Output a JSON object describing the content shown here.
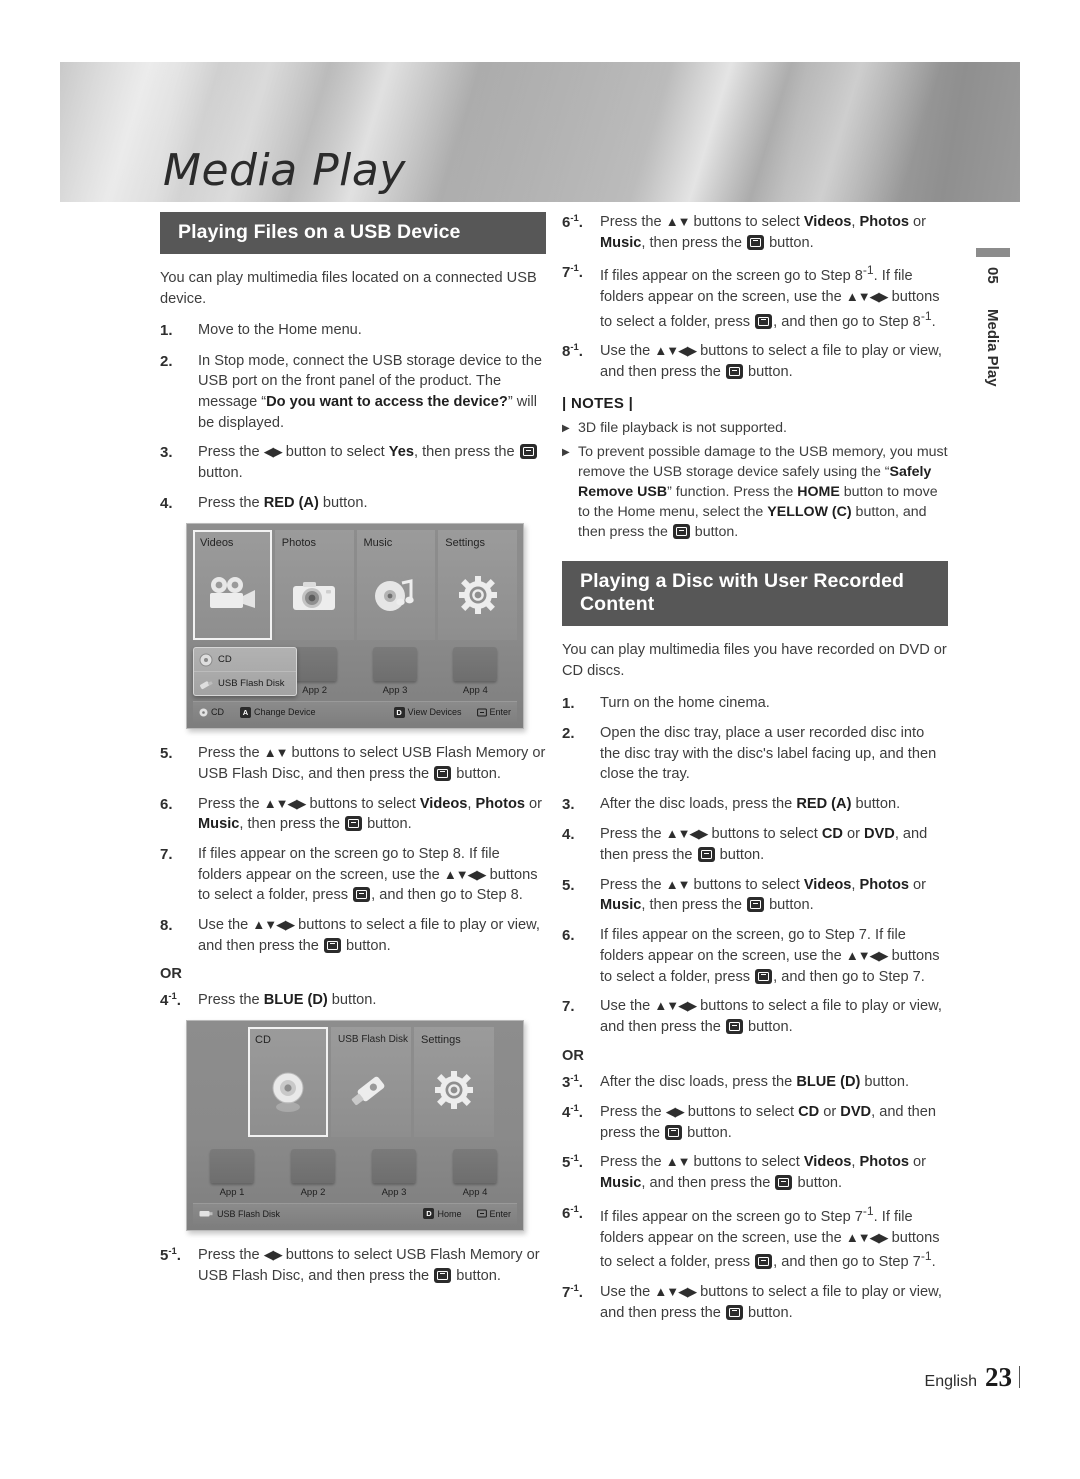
{
  "banner": {
    "title": "Media Play"
  },
  "chapter_tab": {
    "number": "05",
    "name": "Media Play"
  },
  "footer": {
    "language": "English",
    "page_number": "23"
  },
  "left_column": {
    "section_heading": "Playing Files on a USB Device",
    "intro": "You can play multimedia files located on a connected USB device.",
    "steps": [
      {
        "num": "1.",
        "text": "Move to the Home menu."
      },
      {
        "num": "2.",
        "text": "In Stop mode, connect the USB storage device to the USB port on the front panel of the product. The message “Do you want to access the device?” will be displayed."
      },
      {
        "num": "3.",
        "text": "Press the ◀▶ button to select Yes, then press the [ENTER] button."
      },
      {
        "num": "4.",
        "text": "Press the RED (A) button."
      }
    ],
    "steps_after_figure": [
      {
        "num": "5.",
        "text": "Press the ▲▼ buttons to select USB Flash Memory or USB Flash Disc, and then press the [ENTER] button."
      },
      {
        "num": "6.",
        "text": "Press the ▲▼◀▶ buttons to select Videos, Photos or Music, then press the [ENTER] button."
      },
      {
        "num": "7.",
        "text": "If files appear on the screen go to Step 8. If file folders appear on the screen, use the ▲▼◀▶ buttons to select a folder, press [ENTER], and then go to Step 8."
      },
      {
        "num": "8.",
        "text": "Use the ▲▼◀▶ buttons to select a file to play or view, and then press the [ENTER] button."
      }
    ],
    "or_label": "OR",
    "alt_step": {
      "num": "4",
      "sup": "-1",
      "text": "Press the BLUE (D) button."
    },
    "final_step": {
      "num": "5",
      "sup": "-1",
      "text": "Press the ◀▶ buttons to select USB Flash Memory or USB Flash Disc, and then press the [ENTER] button."
    }
  },
  "right_column": {
    "steps_top": [
      {
        "num": "6",
        "sup": "-1",
        "text": "Press the ▲▼ buttons to select Videos, Photos or Music, then press the [ENTER] button."
      },
      {
        "num": "7",
        "sup": "-1",
        "text": "If files appear on the screen go to Step 8-1. If file folders appear on the screen, use the ▲▼◀▶ buttons to select a folder, press [ENTER], and then go to Step 8-1."
      },
      {
        "num": "8",
        "sup": "-1",
        "text": "Use the ▲▼◀▶ buttons to select a file to play or view, and then press the [ENTER] button."
      }
    ],
    "notes_title": "| NOTES |",
    "notes": [
      "3D file playback is not supported.",
      "To prevent possible damage to the USB memory, you must remove the USB storage device safely using the “Safely Remove USB” function. Press the HOME button to move to the Home menu, select the YELLOW (C) button, and then press the [ENTER] button."
    ],
    "section_heading": "Playing a Disc with User Recorded Content",
    "intro": "You can play multimedia files you have recorded on DVD or CD discs.",
    "steps": [
      {
        "num": "1.",
        "text": "Turn on the home cinema."
      },
      {
        "num": "2.",
        "text": "Open the disc tray, place a user recorded disc into the disc tray with the disc's label facing up, and then close the tray."
      },
      {
        "num": "3.",
        "text": "After the disc loads, press the RED (A) button."
      },
      {
        "num": "4.",
        "text": "Press the ▲▼◀▶ buttons to select CD or DVD, and then press the [ENTER] button."
      },
      {
        "num": "5.",
        "text": "Press the ▲▼ buttons to select Videos, Photos or Music, then press the [ENTER] button."
      },
      {
        "num": "6.",
        "text": "If files appear on the screen, go to Step 7. If file folders appear on the screen, use the ▲▼◀▶ buttons to select a folder, press [ENTER], and then go to Step 7."
      },
      {
        "num": "7.",
        "text": "Use the ▲▼◀▶ buttons to select a file to play or view, and then press the [ENTER] button."
      }
    ],
    "or_label": "OR",
    "alt_steps": [
      {
        "num": "3",
        "sup": "-1",
        "text": "After the disc loads, press the BLUE (D) button."
      },
      {
        "num": "4",
        "sup": "-1",
        "text": "Press the ◀▶ buttons to select CD or DVD, and then press the [ENTER] button."
      },
      {
        "num": "5",
        "sup": "-1",
        "text": "Press the ▲▼ buttons to select Videos, Photos or Music, and then press the [ENTER] button."
      },
      {
        "num": "6",
        "sup": "-1",
        "text": "If files appear on the screen go to Step 7-1. If file folders appear on the screen, use the ▲▼◀▶ buttons to select a folder, press [ENTER], and then go to Step 7-1."
      },
      {
        "num": "7",
        "sup": "-1",
        "text": "Use the ▲▼◀▶ buttons to select a file to play or view, and then press the [ENTER] button."
      }
    ]
  },
  "figure_usb_home": {
    "tiles": [
      {
        "label": "Videos",
        "icon": "video-camera-icon",
        "selected": true
      },
      {
        "label": "Photos",
        "icon": "camera-icon",
        "selected": false
      },
      {
        "label": "Music",
        "icon": "music-disc-icon",
        "selected": false
      },
      {
        "label": "Settings",
        "icon": "gear-icon",
        "selected": false
      }
    ],
    "device_popup": [
      {
        "label": "CD",
        "icon": "cd-icon"
      },
      {
        "label": "USB Flash Disk",
        "icon": "usb-icon"
      }
    ],
    "apps": [
      "App 2",
      "App 3",
      "App 4"
    ],
    "status_bar": {
      "current_device": "CD",
      "change_device_key": "A",
      "change_device_label": "Change Device",
      "view_devices_key": "D",
      "view_devices_label": "View Devices",
      "enter_label": "Enter"
    }
  },
  "figure_disc_home": {
    "tiles": [
      {
        "label": "CD",
        "icon": "cd-icon",
        "selected": true
      },
      {
        "label": "USB Flash Disk",
        "icon": "usb-icon",
        "selected": false
      },
      {
        "label": "Settings",
        "icon": "gear-icon",
        "selected": false
      }
    ],
    "apps": [
      "App 1",
      "App 2",
      "App 3",
      "App 4"
    ],
    "status_bar": {
      "current_device": "USB Flash Disk",
      "home_key": "D",
      "home_label": "Home",
      "enter_label": "Enter"
    }
  },
  "colors": {
    "heading_bar": "#575757",
    "body_text": "#3d3d3d",
    "bold_text": "#1f1f1f",
    "mock_background": "#8a8a8a"
  }
}
